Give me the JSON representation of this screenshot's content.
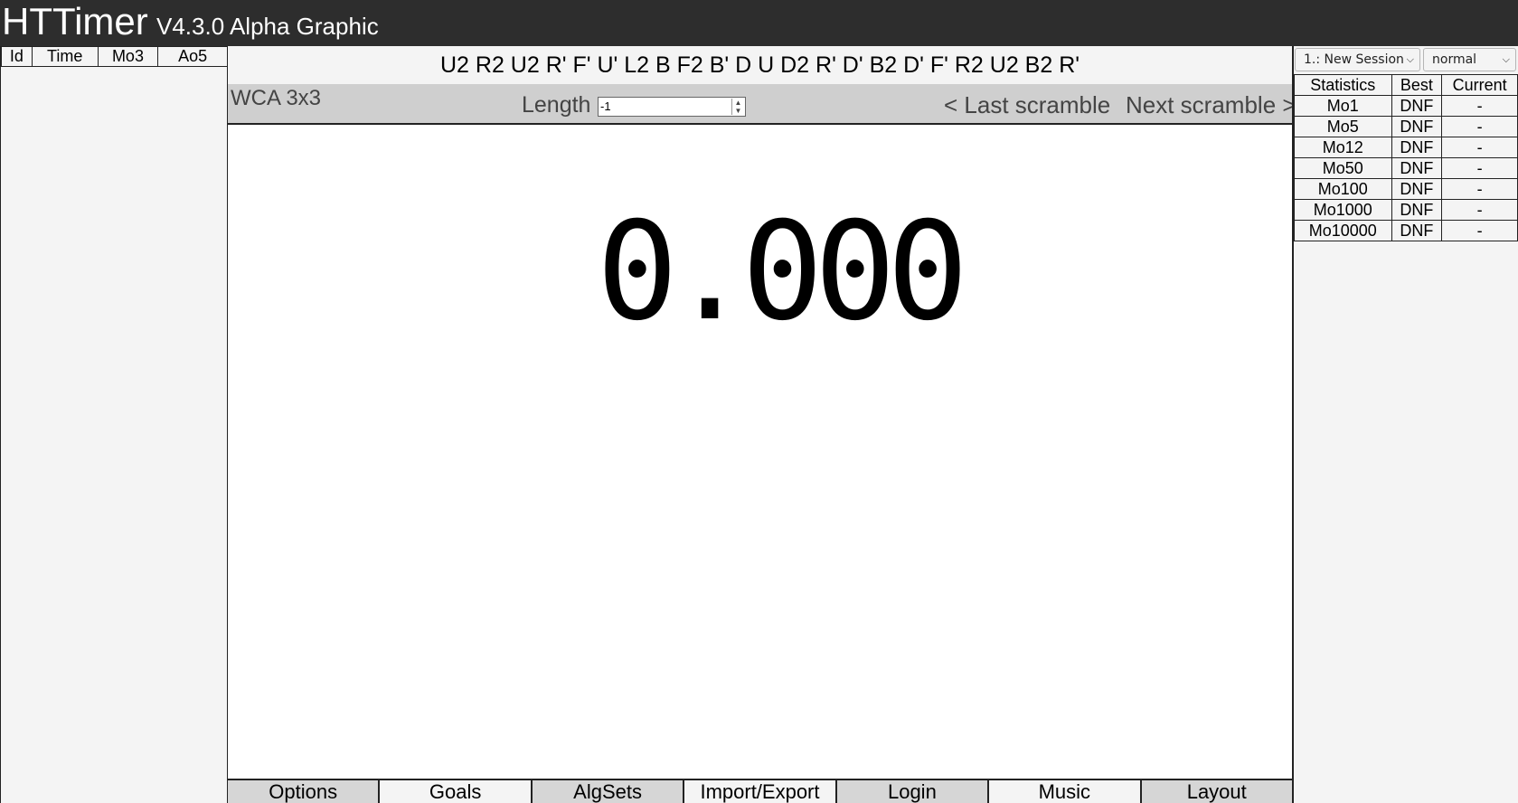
{
  "header": {
    "title": "HTTimer",
    "version": "V4.3.0 Alpha Graphic"
  },
  "times_table": {
    "columns": [
      "Id",
      "Time",
      "Mo3",
      "Ao5"
    ]
  },
  "scramble": {
    "text": "U2 R2 U2 R' F' U' L2 B F2 B' D U D2 R' D' B2 D' F' R2 U2 B2 R'",
    "puzzle": "WCA 3x3",
    "length_label": "Length",
    "length_value": "-1",
    "last_label": "< Last scramble",
    "next_label": "Next scramble >"
  },
  "timer": {
    "display": "0.000"
  },
  "tabs": [
    {
      "label": "Options"
    },
    {
      "label": "Goals"
    },
    {
      "label": "AlgSets"
    },
    {
      "label": "Import/Export"
    },
    {
      "label": "Login"
    },
    {
      "label": "Music"
    },
    {
      "label": "Layout"
    }
  ],
  "session": {
    "selected": "1.: New Session",
    "mode": "normal"
  },
  "statistics": {
    "columns": [
      "Statistics",
      "Best",
      "Current"
    ],
    "rows": [
      {
        "name": "Mo1",
        "best": "DNF",
        "current": "-"
      },
      {
        "name": "Mo5",
        "best": "DNF",
        "current": "-"
      },
      {
        "name": "Mo12",
        "best": "DNF",
        "current": "-"
      },
      {
        "name": "Mo50",
        "best": "DNF",
        "current": "-"
      },
      {
        "name": "Mo100",
        "best": "DNF",
        "current": "-"
      },
      {
        "name": "Mo1000",
        "best": "DNF",
        "current": "-"
      },
      {
        "name": "Mo10000",
        "best": "DNF",
        "current": "-"
      }
    ]
  },
  "icons": {
    "select_chevron": "chevron-down-icon",
    "spinner": "spinner-arrows-icon"
  }
}
